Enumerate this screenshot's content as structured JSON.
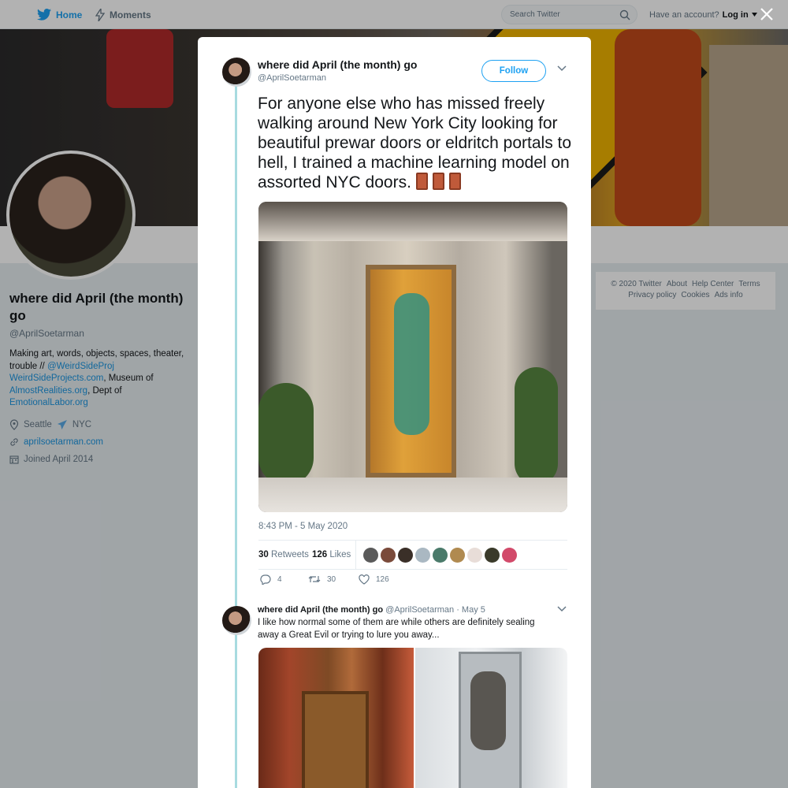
{
  "nav": {
    "home_label": "Home",
    "moments_label": "Moments",
    "search_placeholder": "Search Twitter",
    "account_prompt": "Have an account?",
    "login_label": "Log in"
  },
  "profile": {
    "name": "where did April (the month) go",
    "handle": "@AprilSoetarman",
    "bio_parts": {
      "p1": "Making art, words, objects, spaces, theater, trouble // ",
      "l1": "@WeirdSideProj",
      "l2": "WeirdSideProjects.com",
      "p2": ", Museum of ",
      "l3": "AlmostRealities.org",
      "p3": ", Dept of ",
      "l4": "EmotionalLabor.org"
    },
    "location_a": "Seattle",
    "location_b": "NYC",
    "website": "aprilsoetarman.com",
    "joined": "Joined April 2014"
  },
  "footer": {
    "copyright": "© 2020 Twitter",
    "about": "About",
    "help": "Help Center",
    "terms": "Terms",
    "privacy": "Privacy policy",
    "cookies": "Cookies",
    "ads": "Ads info"
  },
  "tweet": {
    "author_name": "where did April (the month) go",
    "author_handle": "@AprilSoetarman",
    "follow_label": "Follow",
    "text": "For anyone else who has missed freely walking around New York City looking for beautiful prewar doors or eldritch portals to hell, I trained a machine learning model on assorted NYC doors.",
    "emoji_icon": "door-emoji",
    "timestamp": "8:43 PM - 5 May 2020",
    "retweets_count": "30",
    "retweets_label": "Retweets",
    "likes_count": "126",
    "likes_label": "Likes",
    "replies": "4",
    "retweets_action": "30",
    "likes_action": "126"
  },
  "reply": {
    "author_name": "where did April (the month) go",
    "author_handle": "@AprilSoetarman",
    "date": "· May 5",
    "text": "I like how normal some of them are while others are definitely sealing away a Great Evil or trying to lure you away..."
  },
  "colors": {
    "accent": "#1da1f2",
    "link": "#1b95e0",
    "thread": "#a8dbe0"
  }
}
